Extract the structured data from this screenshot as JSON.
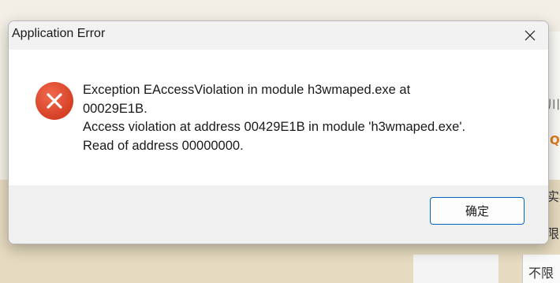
{
  "dialog": {
    "title": "Application Error",
    "message_lines": [
      "Exception EAccessViolation in module h3wmaped.exe at",
      "00029E1B.",
      "Access violation at address 00429E1B in module 'h3wmaped.exe'.",
      "Read of address 00000000."
    ],
    "ok_label": "确定",
    "icon": "error-x-icon",
    "close_icon": "close-icon"
  },
  "background": {
    "fragments": [
      "川",
      "Q",
      "实林",
      "限",
      "不限"
    ]
  },
  "colors": {
    "error_red": "#e1452c",
    "accent_blue": "#0067c0",
    "footer_gray": "#f0f0f0",
    "desktop_tan": "#e6dbc0"
  }
}
